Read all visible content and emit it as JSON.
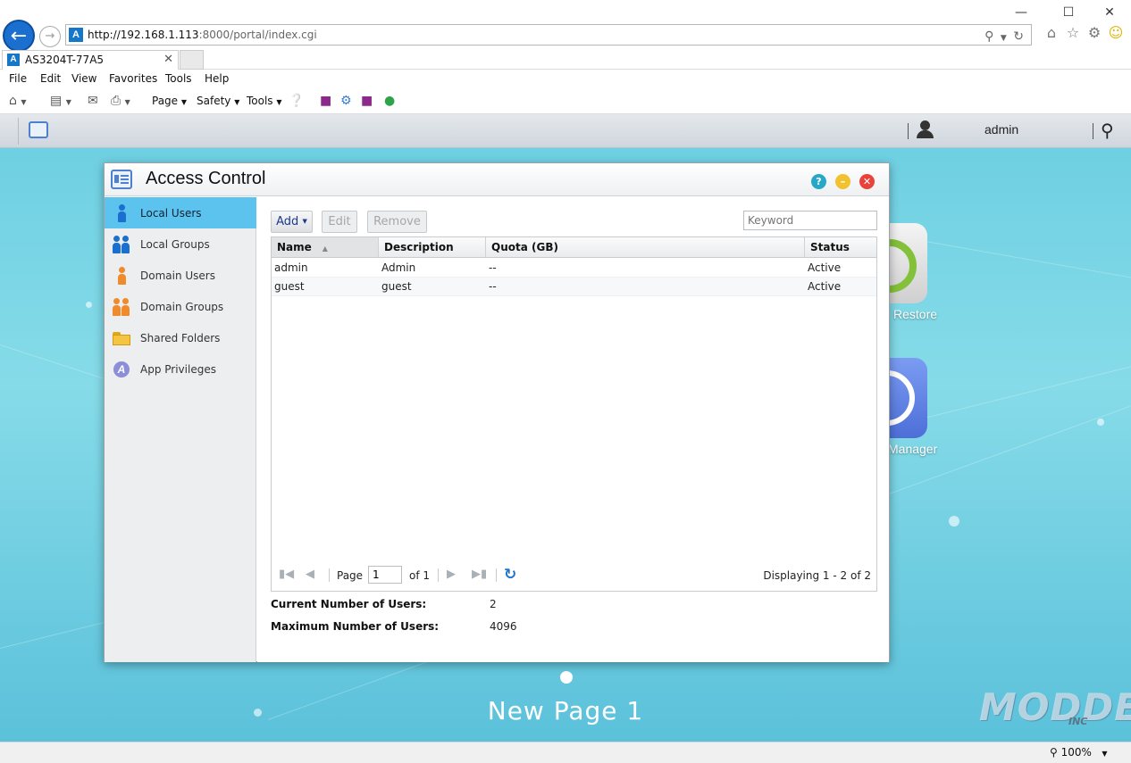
{
  "browser": {
    "url_host": "http://192.168.1.113",
    "url_rest": ":8000/portal/index.cgi",
    "tab_title": "AS3204T-77A5",
    "favicon_letter": "A",
    "menu": [
      "File",
      "Edit",
      "View",
      "Favorites",
      "Tools",
      "Help"
    ],
    "commands": {
      "page": "Page",
      "safety": "Safety",
      "tools": "Tools"
    },
    "zoom": "100%"
  },
  "adm": {
    "username": "admin",
    "desktop_page": "New Page 1",
    "apps": [
      {
        "label": "Restore"
      },
      {
        "label": "Manager"
      }
    ],
    "watermark": "MODDERS",
    "watermark_inc": "INC"
  },
  "window": {
    "title": "Access Control",
    "sidebar": [
      {
        "label": "Local Users",
        "active": true
      },
      {
        "label": "Local Groups"
      },
      {
        "label": "Domain Users"
      },
      {
        "label": "Domain Groups"
      },
      {
        "label": "Shared Folders"
      },
      {
        "label": "App Privileges"
      }
    ],
    "toolbar": {
      "add": "Add",
      "edit": "Edit",
      "remove": "Remove",
      "search_placeholder": "Keyword"
    },
    "grid": {
      "columns": [
        "Name",
        "Description",
        "Quota (GB)",
        "Status"
      ],
      "rows": [
        {
          "name": "admin",
          "description": "Admin",
          "quota": "--",
          "status": "Active"
        },
        {
          "name": "guest",
          "description": "guest",
          "quota": "--",
          "status": "Active"
        }
      ]
    },
    "pager": {
      "page_label": "Page",
      "page_value": "1",
      "of_label": "of 1",
      "display": "Displaying 1 - 2 of 2"
    },
    "stats": {
      "current_label": "Current Number of Users:",
      "current_value": "2",
      "max_label": "Maximum Number of Users:",
      "max_value": "4096"
    }
  },
  "colors": {
    "accent": "#5bc3ee",
    "desktop": "#7fd7e6",
    "link": "#1b3a8a"
  }
}
